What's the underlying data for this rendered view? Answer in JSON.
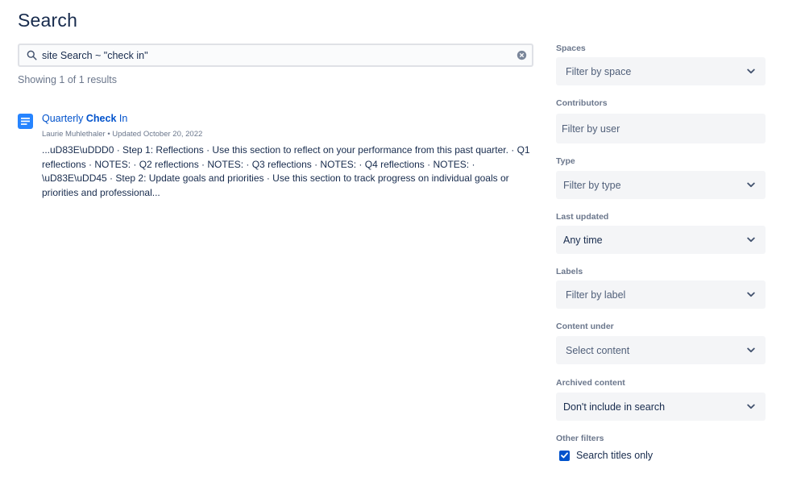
{
  "page": {
    "title": "Search"
  },
  "search": {
    "value": "site Search ~ \"check in\"",
    "placeholder": ""
  },
  "results_summary": "Showing 1 of 1 results",
  "results": [
    {
      "title_prefix": "Quarterly ",
      "title_match": "Check",
      "title_suffix": " In",
      "meta": "Laurie Muhlethaler • Updated October 20, 2022",
      "excerpt": "...uD83E\\uDDD0 ·  Step 1: Reflections · Use this section to reflect on your performance from this past quarter. · Q1 reflections · NOTES: · Q2 reflections · NOTES: · Q3 reflections · NOTES: · Q4 reflections · NOTES: · \\uD83E\\uDD45 ·  Step 2: Update goals and priorities · Use this section to track progress on individual goals or priorities and professional...",
      "icon": "page-icon"
    }
  ],
  "filters": {
    "spaces": {
      "label": "Spaces",
      "value": "Filter by space"
    },
    "contributors": {
      "label": "Contributors",
      "value": "Filter by user"
    },
    "type": {
      "label": "Type",
      "value": "Filter by type"
    },
    "last_updated": {
      "label": "Last updated",
      "value": "Any time"
    },
    "labels": {
      "label": "Labels",
      "value": "Filter by label"
    },
    "content_under": {
      "label": "Content under",
      "value": "Select content"
    },
    "archived_content": {
      "label": "Archived content",
      "value": "Don't include in search"
    },
    "other_filters": {
      "label": "Other filters",
      "search_titles_only": "Search titles only",
      "search_titles_only_checked": true
    }
  },
  "colors": {
    "accent": "#0052cc",
    "text": "#172b4d",
    "muted": "#6b778c",
    "field_bg": "#f4f5f7"
  }
}
